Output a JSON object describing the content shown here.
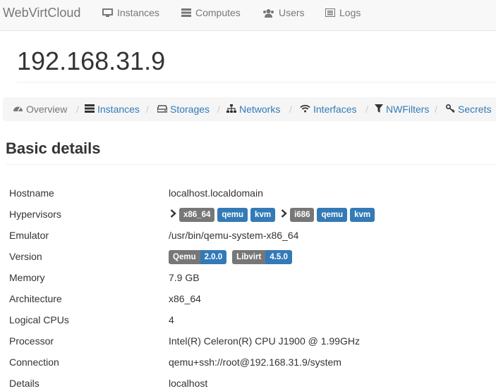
{
  "brand": "WebVirtCloud",
  "nav": {
    "instances": "Instances",
    "computes": "Computes",
    "users": "Users",
    "logs": "Logs"
  },
  "page_title": "192.168.31.9",
  "breadcrumb": {
    "overview": "Overview",
    "instances": "Instances",
    "storages": "Storages",
    "networks": "Networks",
    "interfaces": "Interfaces",
    "nwfilters": "NWFilters",
    "secrets": "Secrets",
    "separator": "/"
  },
  "section_title": "Basic details",
  "details": {
    "hostname": {
      "label": "Hostname",
      "value": "localhost.localdomain"
    },
    "hypervisors": {
      "label": "Hypervisors",
      "groups": [
        {
          "arch": "x86_64",
          "machines": [
            "qemu",
            "kvm"
          ]
        },
        {
          "arch": "i686",
          "machines": [
            "qemu",
            "kvm"
          ]
        }
      ]
    },
    "emulator": {
      "label": "Emulator",
      "value": "/usr/bin/qemu-system-x86_64"
    },
    "version": {
      "label": "Version",
      "qemu_name": "Qemu",
      "qemu_version": "2.0.0",
      "libvirt_name": "Libvirt",
      "libvirt_version": "4.5.0"
    },
    "memory": {
      "label": "Memory",
      "value": "7.9 GB"
    },
    "architecture": {
      "label": "Architecture",
      "value": "x86_64"
    },
    "logical_cpus": {
      "label": "Logical CPUs",
      "value": "4"
    },
    "processor": {
      "label": "Processor",
      "value": "Intel(R) Celeron(R) CPU J1900 @ 1.99GHz"
    },
    "connection": {
      "label": "Connection",
      "value": "qemu+ssh://root@192.168.31.9/system"
    },
    "details": {
      "label": "Details",
      "value": "localhost"
    }
  },
  "colors": {
    "link": "#337ab7",
    "label_gray": "#777777",
    "label_blue": "#337ab7",
    "navbar_bg": "#f8f8f8",
    "breadcrumb_bg": "#f5f5f5"
  }
}
